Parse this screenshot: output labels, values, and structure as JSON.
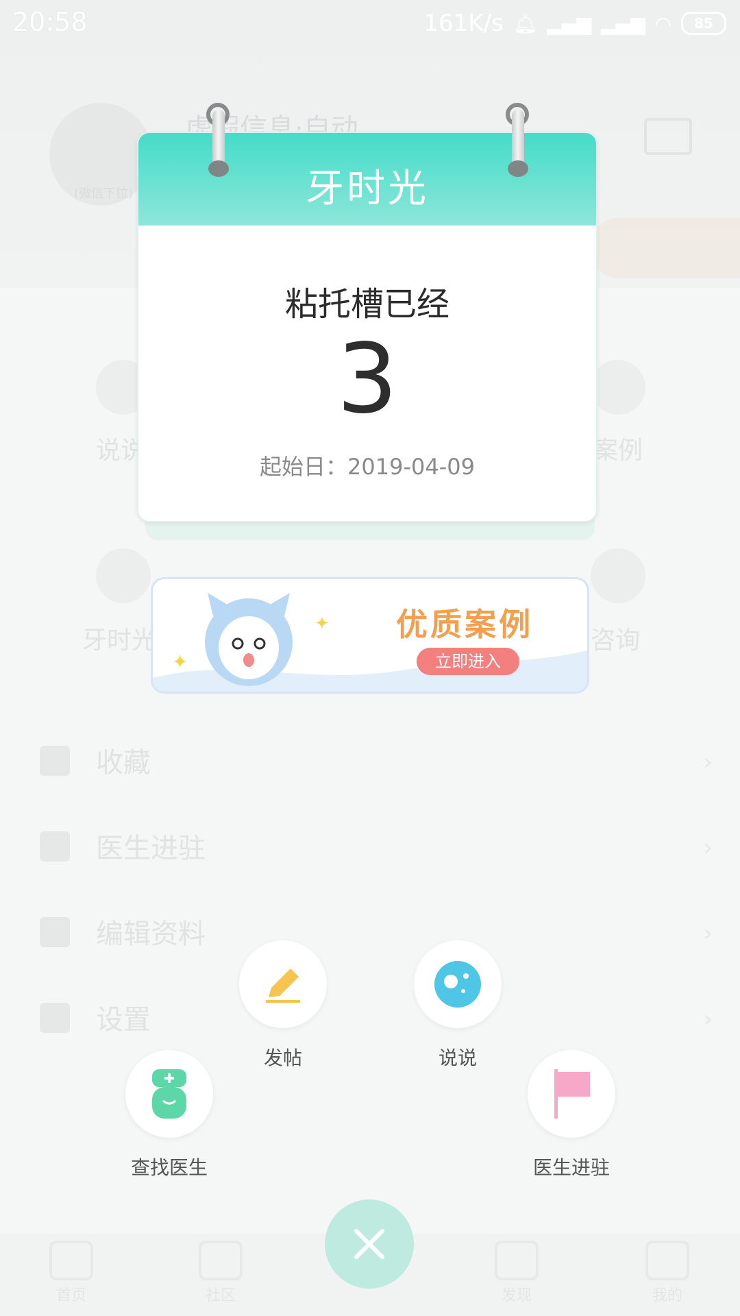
{
  "statusbar": {
    "time": "20:58",
    "speed": "161K/s",
    "battery": "85"
  },
  "background": {
    "username": "虚假信息·自动",
    "avatar_tip": "(微信下拉)",
    "grid_left_top": "说说",
    "grid_right_top": "案例",
    "grid_left_mid": "牙时光",
    "grid_right_mid": "咨询",
    "menu": [
      "收藏",
      "医生进驻",
      "编辑资料",
      "设置"
    ],
    "tabs": [
      "首页",
      "社区",
      "发现",
      "我的"
    ]
  },
  "calendar": {
    "title": "牙时光",
    "caption": "粘托槽已经",
    "days": "3",
    "start_date": "起始日：2019-04-09"
  },
  "banner": {
    "title": "优质案例",
    "cta": "立即进入"
  },
  "actions": {
    "post": "发帖",
    "talk": "说说",
    "find_doctor": "查找医生",
    "doctor_join": "医生进驻"
  },
  "colors": {
    "accent": "#45dcc8",
    "banner_title": "#f2a050",
    "banner_cta": "#f47f7f",
    "close_button": "#bfeadf",
    "post_icon": "#f6c44f",
    "talk_icon": "#4fc6e6",
    "doctor_icon": "#5dd6a8",
    "flag_icon": "#f7a8c8"
  }
}
